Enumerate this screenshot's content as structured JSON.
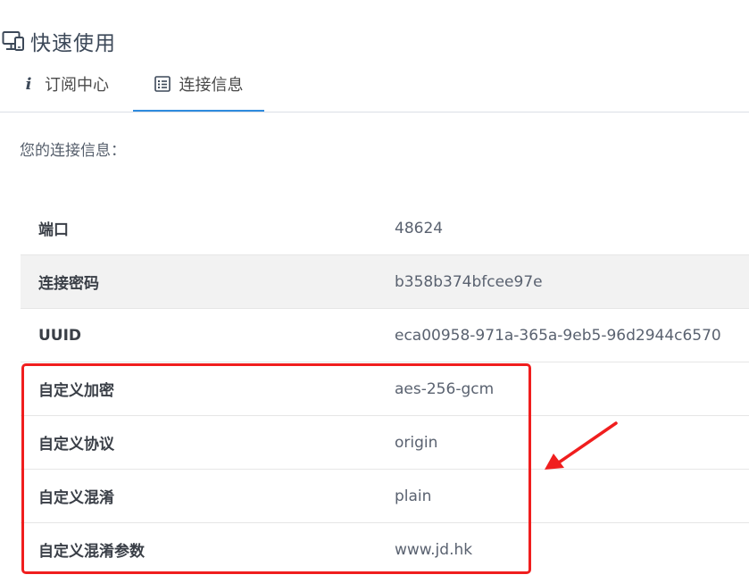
{
  "header": {
    "title": "快速使用",
    "icon": "monitor-icon"
  },
  "tabs": [
    {
      "label": "订阅中心",
      "icon": "info-icon",
      "active": false
    },
    {
      "label": "连接信息",
      "icon": "list-icon",
      "active": true
    }
  ],
  "intro_text": "您的连接信息：",
  "rows": [
    {
      "key": "端口",
      "value": "48624"
    },
    {
      "key": "连接密码",
      "value": "b358b374bfcee97e"
    },
    {
      "key": "UUID",
      "value": "eca00958-971a-365a-9eb5-96d2944c6570"
    },
    {
      "key": "自定义加密",
      "value": "aes-256-gcm"
    },
    {
      "key": "自定义协议",
      "value": "origin"
    },
    {
      "key": "自定义混淆",
      "value": "plain"
    },
    {
      "key": "自定义混淆参数",
      "value": "www.jd.hk"
    }
  ],
  "colors": {
    "accent": "#2f8bde",
    "annotation": "#f01e1e"
  }
}
